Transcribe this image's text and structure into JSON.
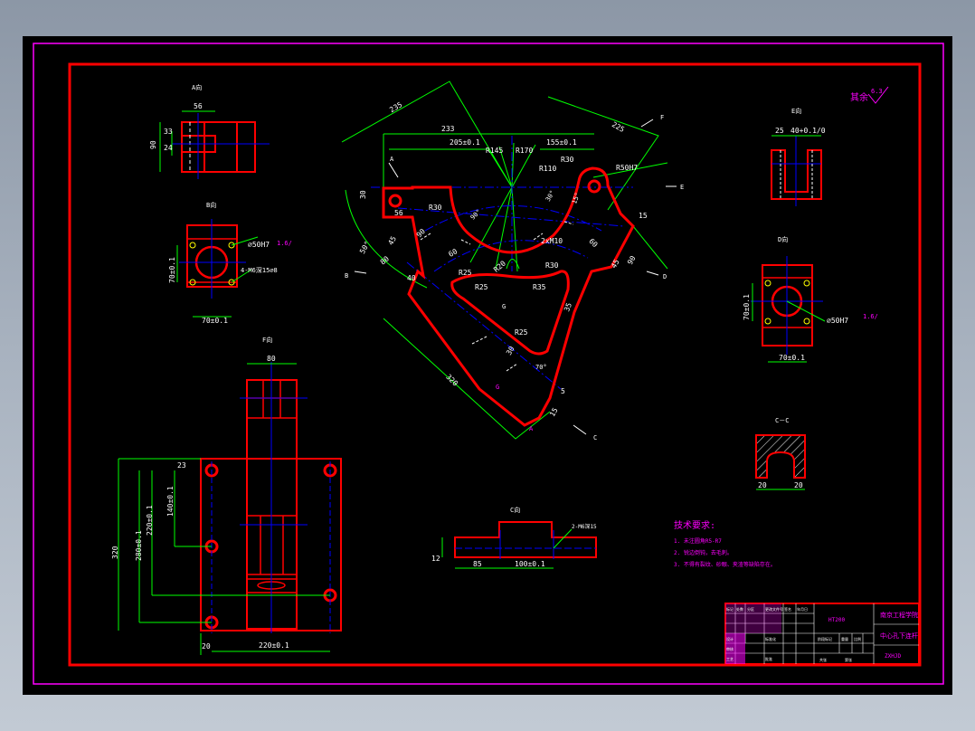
{
  "colors": {
    "background": "#000000",
    "outline": "#ff0000",
    "dimension": "#00ff00",
    "center": "#0000ff",
    "text": "#ffffff",
    "annotation": "#ff00ff"
  },
  "views": {
    "a": {
      "label": "A向",
      "dims": [
        "56",
        "90",
        "33",
        "24"
      ]
    },
    "b": {
      "label": "B向",
      "dims": [
        "70±0.1",
        "70±0.1",
        "∅50H7",
        "4-M6深15∅8",
        "1.6/"
      ]
    },
    "c": {
      "label": "C向",
      "dims": [
        "85",
        "100±0.1",
        "2-M6深15",
        "12"
      ]
    },
    "d": {
      "label": "D向",
      "dims": [
        "70±0.1",
        "70±0.1",
        "∅50H7",
        "1.6/"
      ]
    },
    "e": {
      "label": "E向",
      "dims": [
        "25",
        "40+0.1/0"
      ]
    },
    "f": {
      "label": "F向",
      "dims": [
        "80",
        "320",
        "280±0.1",
        "220±0.1",
        "140±0.1",
        "20",
        "20",
        "220±0.1",
        "23"
      ]
    },
    "cc": {
      "label": "C－C",
      "dims": [
        "20",
        "20"
      ]
    },
    "main": {
      "dims": [
        "235",
        "233",
        "205±0.1",
        "R145",
        "R170",
        "155±0.1",
        "225",
        "R110",
        "R30",
        "R50H7",
        "30°",
        "15°",
        "56",
        "30",
        "R30",
        "15",
        "45",
        "90",
        "90°",
        "80",
        "40",
        "60",
        "R25",
        "R20",
        "R30",
        "R35",
        "2xM10",
        "90",
        "45",
        "60",
        "50°",
        "R25",
        "35",
        "R25",
        "30",
        "320",
        "70°",
        "15",
        "5",
        "A",
        "B",
        "C",
        "D",
        "E",
        "F",
        "G",
        "A",
        "G",
        "S"
      ]
    }
  },
  "surface_mark": {
    "label": "其余",
    "value": "6.3"
  },
  "tech_requirements": {
    "title": "技术要求:",
    "items": [
      "1. 未注圆角R5-R7",
      "2. 锐边倒钝，去毛刺。",
      "3. 不得有裂纹、砂眼、夹渣等缺陷存在。"
    ]
  },
  "title_block": {
    "drawing_no": "ZXHJD",
    "school": "南京工程学院",
    "part_name": "中心孔下连杆",
    "material": "HT200",
    "row_labels": [
      "标记",
      "处数",
      "分区",
      "更改文件号",
      "签名",
      "年月日",
      "设计",
      "审核",
      "工艺",
      "标准化",
      "批准"
    ],
    "mid_labels": [
      "阶段标记",
      "重量",
      "比例",
      "共张",
      "第张"
    ]
  }
}
